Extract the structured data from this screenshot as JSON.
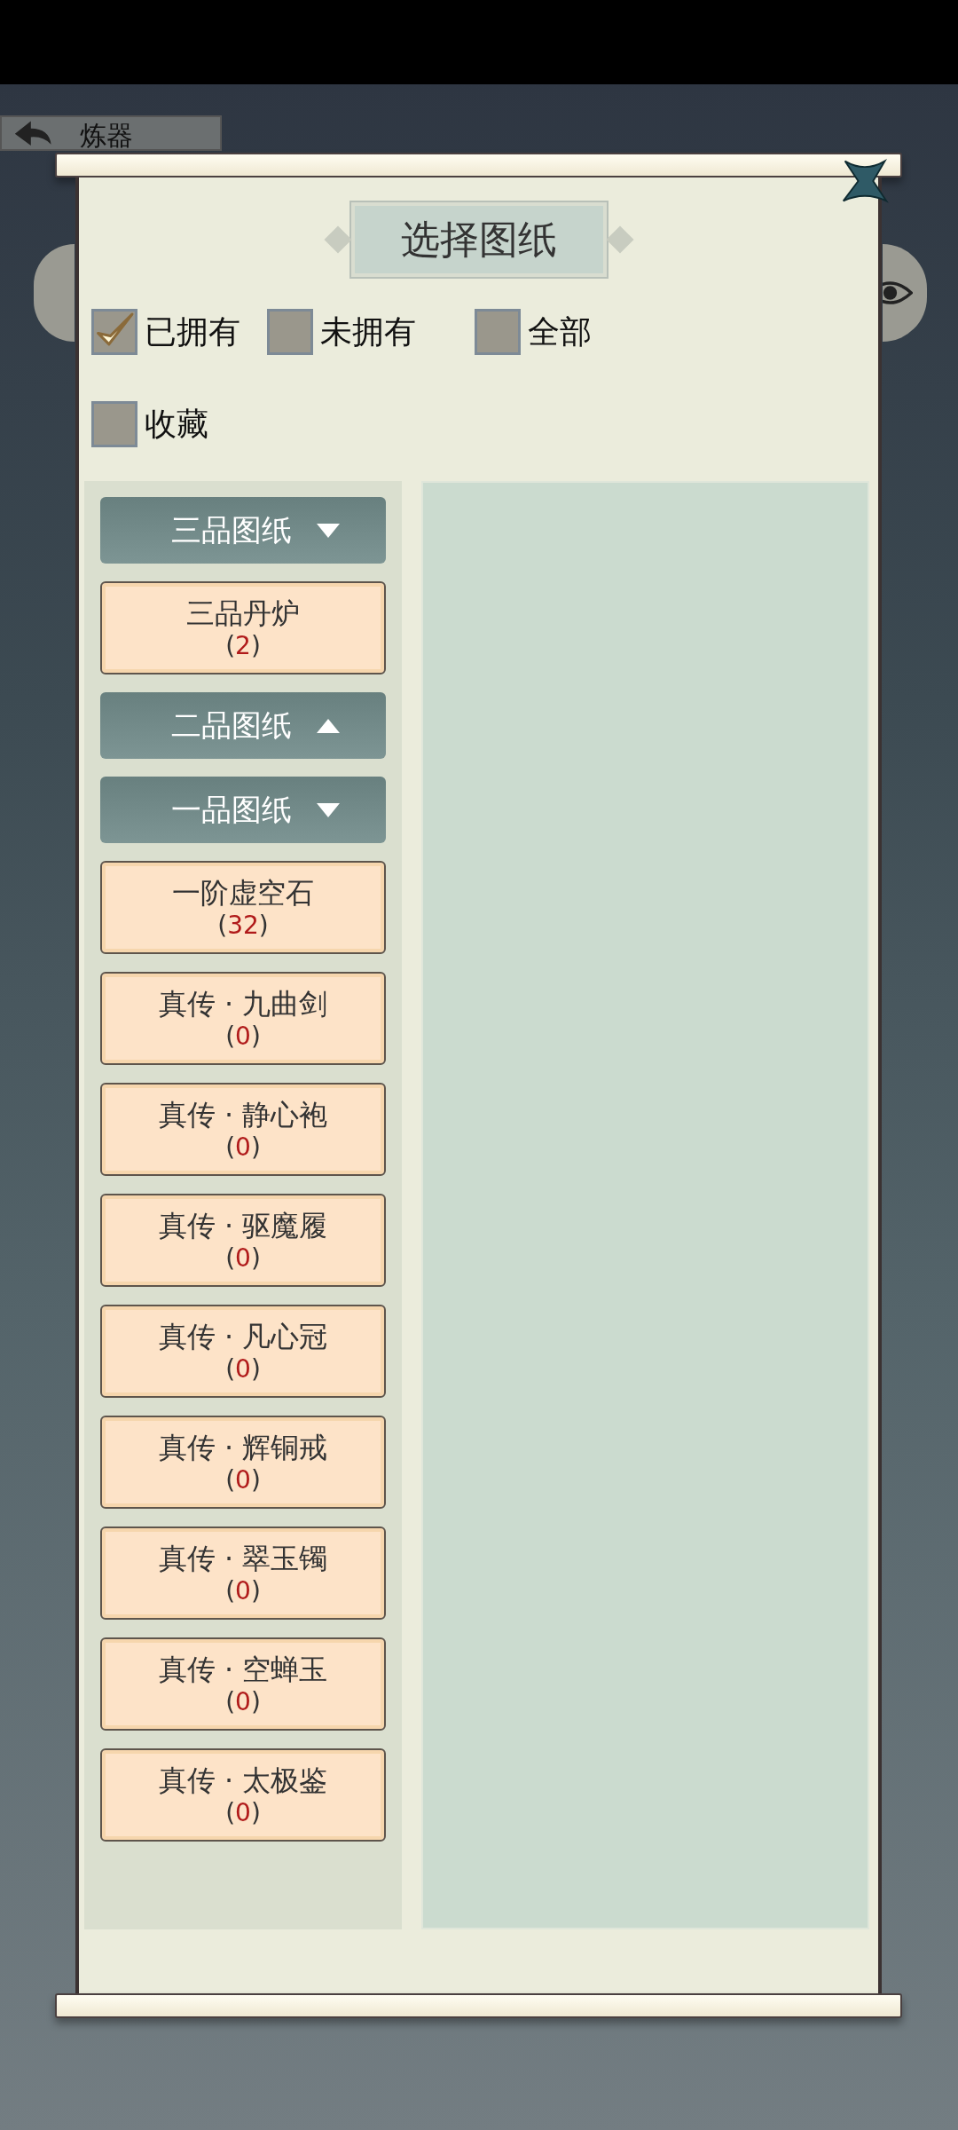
{
  "back_title": "炼器",
  "dialog": {
    "title": "选择图纸",
    "filters": [
      {
        "label": "已拥有",
        "checked": true
      },
      {
        "label": "未拥有",
        "checked": false
      },
      {
        "label": "全部",
        "checked": false
      },
      {
        "label": "收藏",
        "checked": false
      }
    ],
    "groups": [
      {
        "label": "三品图纸",
        "expanded": true,
        "items": [
          {
            "name": "三品丹炉",
            "count": "(2)"
          }
        ]
      },
      {
        "label": "二品图纸",
        "expanded": false
      },
      {
        "label": "一品图纸",
        "expanded": true,
        "items": [
          {
            "name": "一阶虚空石",
            "count": "(32)"
          },
          {
            "name": "真传 · 九曲剑",
            "count": "(0)"
          },
          {
            "name": "真传 · 静心袍",
            "count": "(0)"
          },
          {
            "name": "真传 · 驱魔履",
            "count": "(0)"
          },
          {
            "name": "真传 · 凡心冠",
            "count": "(0)"
          },
          {
            "name": "真传 · 辉铜戒",
            "count": "(0)"
          },
          {
            "name": "真传 · 翠玉镯",
            "count": "(0)"
          },
          {
            "name": "真传 · 空蝉玉",
            "count": "(0)"
          },
          {
            "name": "真传 · 太极鉴",
            "count": "(0)"
          }
        ]
      }
    ]
  }
}
